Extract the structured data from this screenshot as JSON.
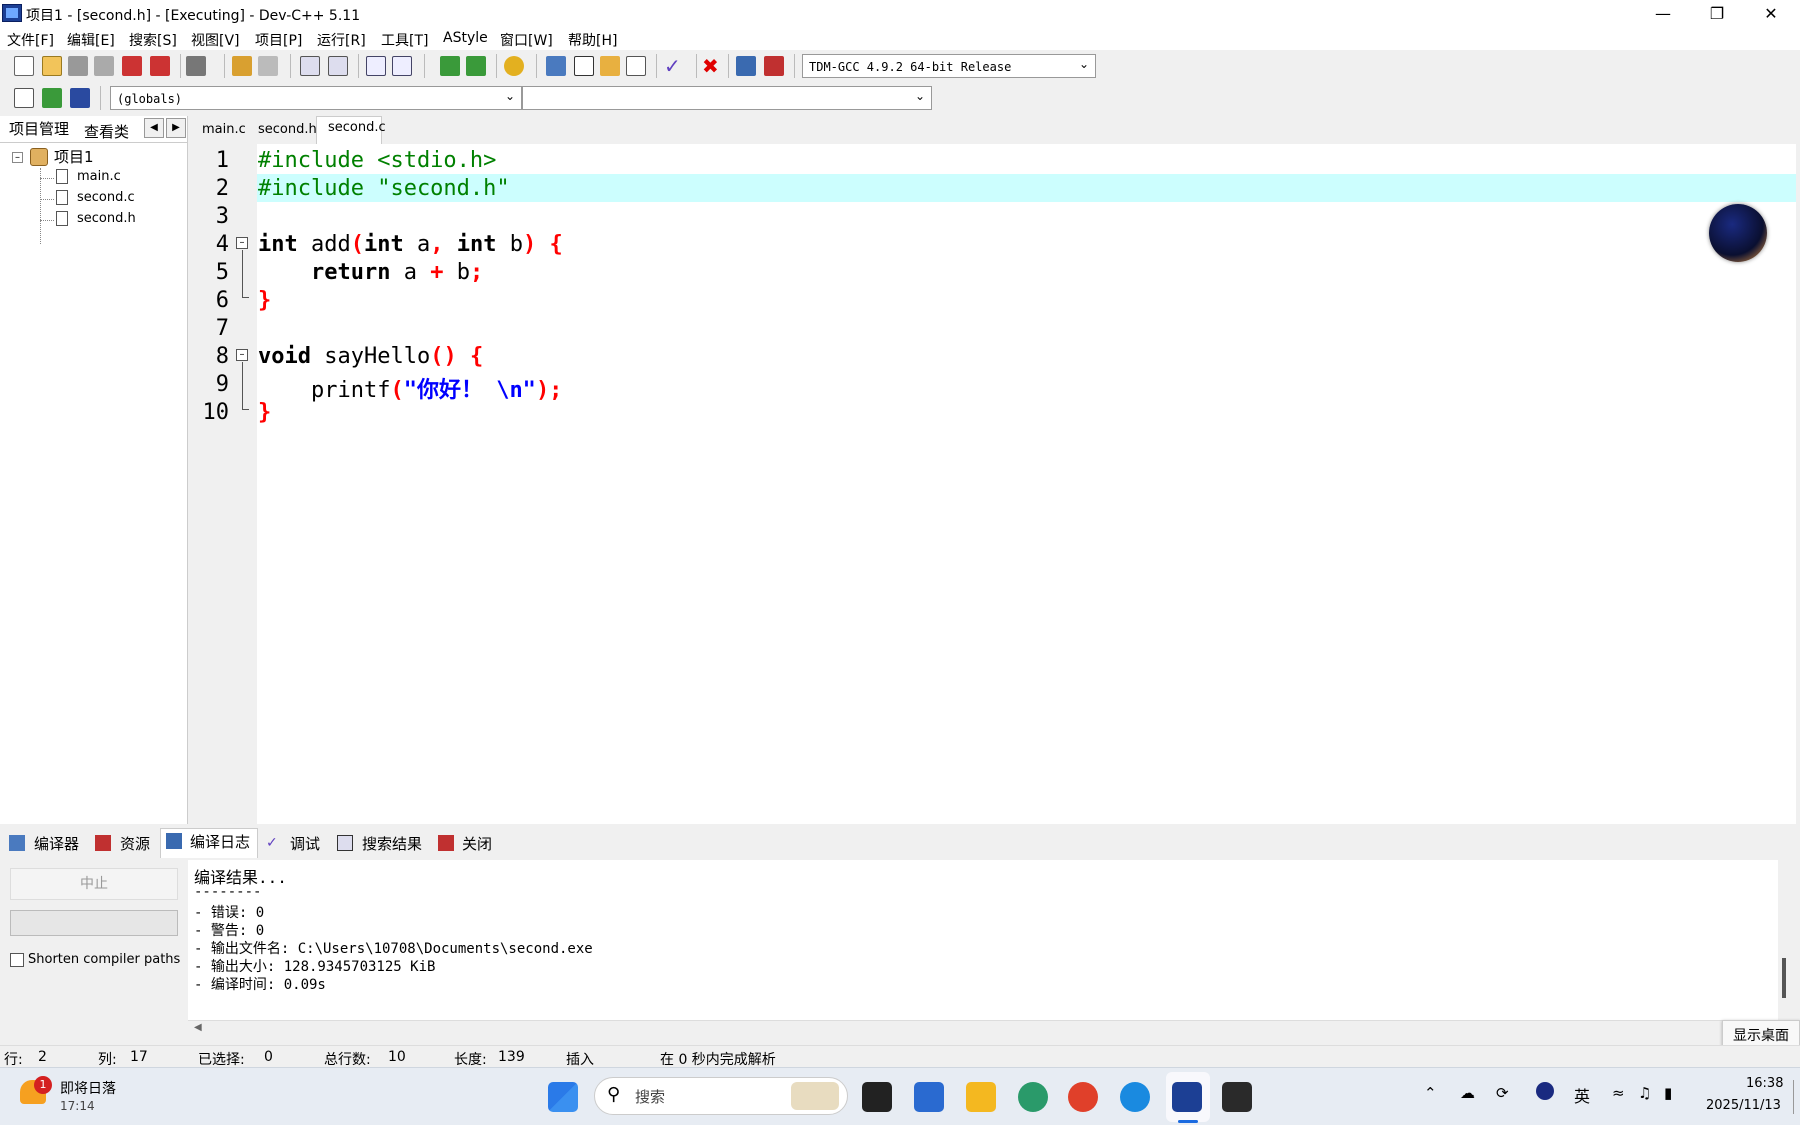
{
  "window": {
    "title": "项目1 - [second.h] - [Executing] - Dev-C++ 5.11"
  },
  "menu": [
    "文件[F]",
    "编辑[E]",
    "搜索[S]",
    "视图[V]",
    "项目[P]",
    "运行[R]",
    "工具[T]",
    "AStyle",
    "窗口[W]",
    "帮助[H]"
  ],
  "toolbar": {
    "compiler": "TDM-GCC 4.9.2 64-bit Release",
    "scope": "(globals)",
    "function": ""
  },
  "left_panel": {
    "tabs": [
      "项目管理",
      "查看类"
    ],
    "project": "项目1",
    "files": [
      "main.c",
      "second.c",
      "second.h"
    ]
  },
  "editor_tabs": [
    "main.c",
    "second.h",
    "second.c"
  ],
  "editor": {
    "line_numbers": [
      "1",
      "2",
      "3",
      "4",
      "5",
      "6",
      "7",
      "8",
      "9",
      "10"
    ],
    "l1": "#include <stdio.h>",
    "l2": "#include \"second.h\"",
    "l4_kw": "int",
    "l4_fn": " add",
    "l4_p1": "(",
    "l4_kw2": "int",
    "l4_a": " a",
    "l4_comma": ",",
    "l4_kw3": " int",
    "l4_b": " b",
    "l4_close": ")",
    "l4_brace": " {",
    "l5_kw": "    return",
    "l5_a": " a ",
    "l5_plus": "+",
    "l5_b": " b",
    "l5_semi": ";",
    "l6": "}",
    "l8_kw": "void",
    "l8_fn": " sayHello",
    "l8_paren": "()",
    "l8_brace": " {",
    "l9_fn": "    printf",
    "l9_open": "(",
    "l9_str": "\"你好！ \\n\"",
    "l9_close": ");",
    "l10": "}"
  },
  "bottom_tabs": [
    "编译器",
    "资源",
    "编译日志",
    "调试",
    "搜索结果",
    "关闭"
  ],
  "bottom_left": {
    "abort": "中止",
    "shorten": "Shorten compiler paths"
  },
  "output": [
    "编译结果...",
    "--------",
    "- 错误: 0",
    "- 警告: 0",
    "- 输出文件名: C:\\Users\\10708\\Documents\\second.exe",
    "- 输出大小: 128.9345703125 KiB",
    "- 编译时间: 0.09s"
  ],
  "tooltip": "显示桌面",
  "status": {
    "row_label": "行:",
    "row": "2",
    "col_label": "列:",
    "col": "17",
    "sel_label": "已选择:",
    "sel": "0",
    "total_label": "总行数:",
    "total": "10",
    "len_label": "长度:",
    "len": "139",
    "mode": "插入",
    "parse": "在 0 秒内完成解析"
  },
  "taskbar": {
    "weather_badge": "1",
    "weather_title": "即将日落",
    "weather_time": "17:14",
    "search": "搜索",
    "ime": "英",
    "clock_time": "16:38",
    "clock_date": "2025/11/13"
  },
  "colors": {
    "highlight_line": "#ccfefe",
    "preprocessor": "#008000",
    "symbol": "#ff0000",
    "string": "#0000ff"
  }
}
